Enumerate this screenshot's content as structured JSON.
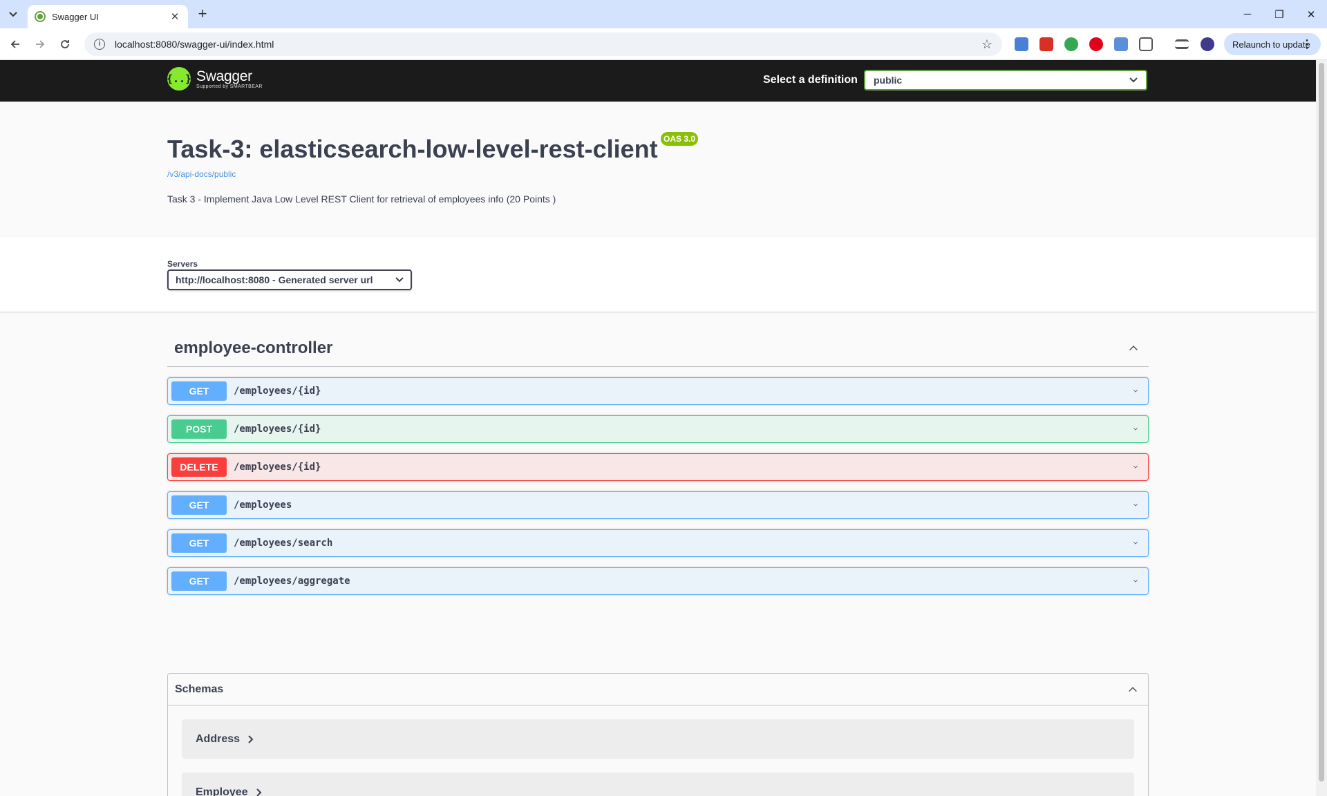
{
  "browser": {
    "tab_title": "Swagger UI",
    "url": "localhost:8080/swagger-ui/index.html",
    "relaunch_label": "Relaunch to update"
  },
  "topbar": {
    "logo_name": "Swagger",
    "logo_sub": "Supported by SMARTBEAR",
    "definition_label": "Select a definition",
    "definition_value": "public"
  },
  "info": {
    "title": "Task-3: elasticsearch-low-level-rest-client",
    "oas_badge": "OAS 3.0",
    "spec_link": "/v3/api-docs/public",
    "description": "Task 3 - Implement Java Low Level REST Client for retrieval of employees info (20 Points )"
  },
  "servers": {
    "label": "Servers",
    "selected": "http://localhost:8080 - Generated server url"
  },
  "tag": {
    "name": "employee-controller",
    "operations": [
      {
        "method": "GET",
        "path": "/employees/{id}"
      },
      {
        "method": "POST",
        "path": "/employees/{id}"
      },
      {
        "method": "DELETE",
        "path": "/employees/{id}"
      },
      {
        "method": "GET",
        "path": "/employees"
      },
      {
        "method": "GET",
        "path": "/employees/search"
      },
      {
        "method": "GET",
        "path": "/employees/aggregate"
      }
    ]
  },
  "schemas": {
    "title": "Schemas",
    "models": [
      "Address",
      "Employee"
    ]
  },
  "colors": {
    "get": "#61affe",
    "post": "#49cc90",
    "delete": "#f93e3e",
    "swagger_green": "#85ea2d",
    "oas_badge": "#89bf04"
  }
}
